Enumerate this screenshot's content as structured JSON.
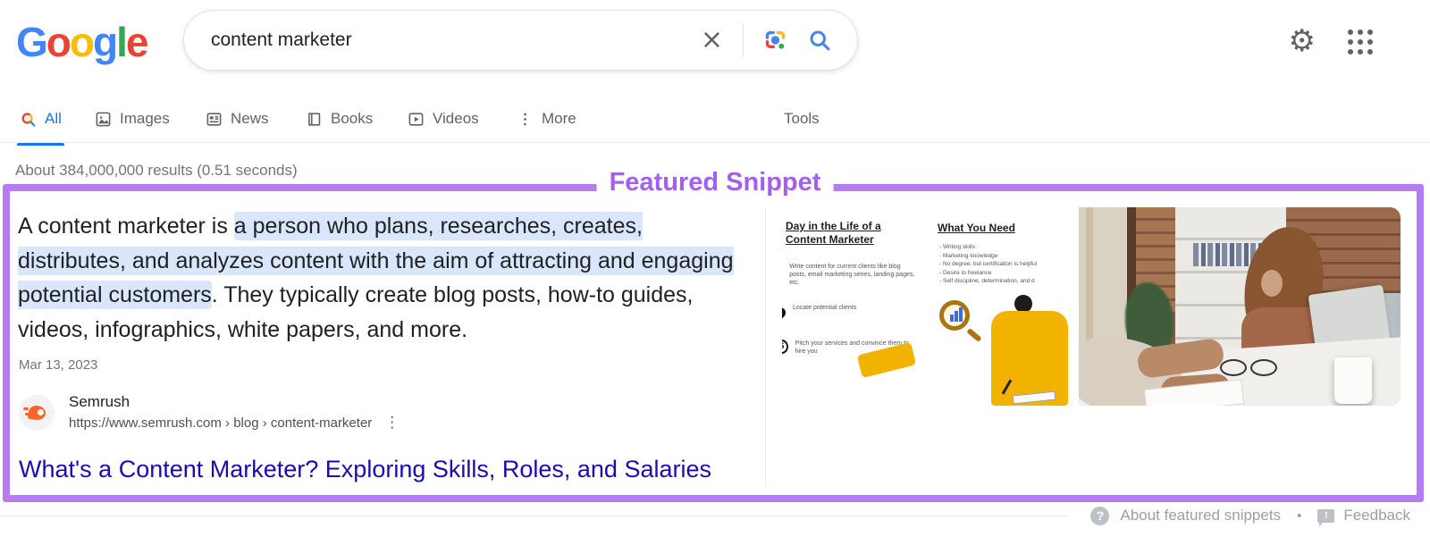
{
  "header": {
    "logo_letters": [
      "G",
      "o",
      "o",
      "g",
      "l",
      "e"
    ],
    "search_query": "content marketer",
    "clear_glyph": "×",
    "gear_glyph": "⚙"
  },
  "tabs": [
    {
      "label": "All"
    },
    {
      "label": "Images"
    },
    {
      "label": "News"
    },
    {
      "label": "Books"
    },
    {
      "label": "Videos"
    },
    {
      "label": "More"
    }
  ],
  "tools_label": "Tools",
  "results_stats": "About 384,000,000 results (0.51 seconds)",
  "featured_snippet": {
    "label": "Featured Snippet",
    "text_before": "A content marketer is ",
    "text_highlight": "a person who plans, researches, creates, distributes, and analyzes content with the aim of attracting and engaging potential customers",
    "text_after": ". They typically create blog posts, how-to guides, videos, infographics, white papers, and more.",
    "date": "Mar 13, 2023",
    "source_name": "Semrush",
    "source_url": "https://www.semrush.com › blog › content-marketer",
    "menu_glyph": "⋮",
    "title": "What's a Content Marketer? Exploring Skills, Roles, and Salaries",
    "infographic": {
      "heading": "Day in the Life of a Content Marketer",
      "steps": [
        "Write content for current clients like blog posts, email marketing series, landing pages, etc.",
        "Locate potential clients",
        "Pitch your services and convince them to hire you"
      ],
      "dollar_glyph": "$",
      "needs_heading": "What You Need",
      "needs": [
        "Writing skills",
        "Marketing knowledge",
        "No degree, but certification is helpful",
        "Desire to freelance",
        "Self discipline, determination, and d"
      ]
    }
  },
  "footer": {
    "help_glyph": "?",
    "about_label": "About featured snippets",
    "separator": "•",
    "feedback_glyph": "!",
    "feedback_label": "Feedback"
  },
  "colors": {
    "snippet_border_purple": "#b77bf1",
    "snippet_label_purple": "#a25ff0",
    "highlight_blue": "#d9e6fb",
    "link_blue": "#1a0dab",
    "active_tab_blue": "#1a73e8",
    "icon_blue": "#4285f4"
  }
}
